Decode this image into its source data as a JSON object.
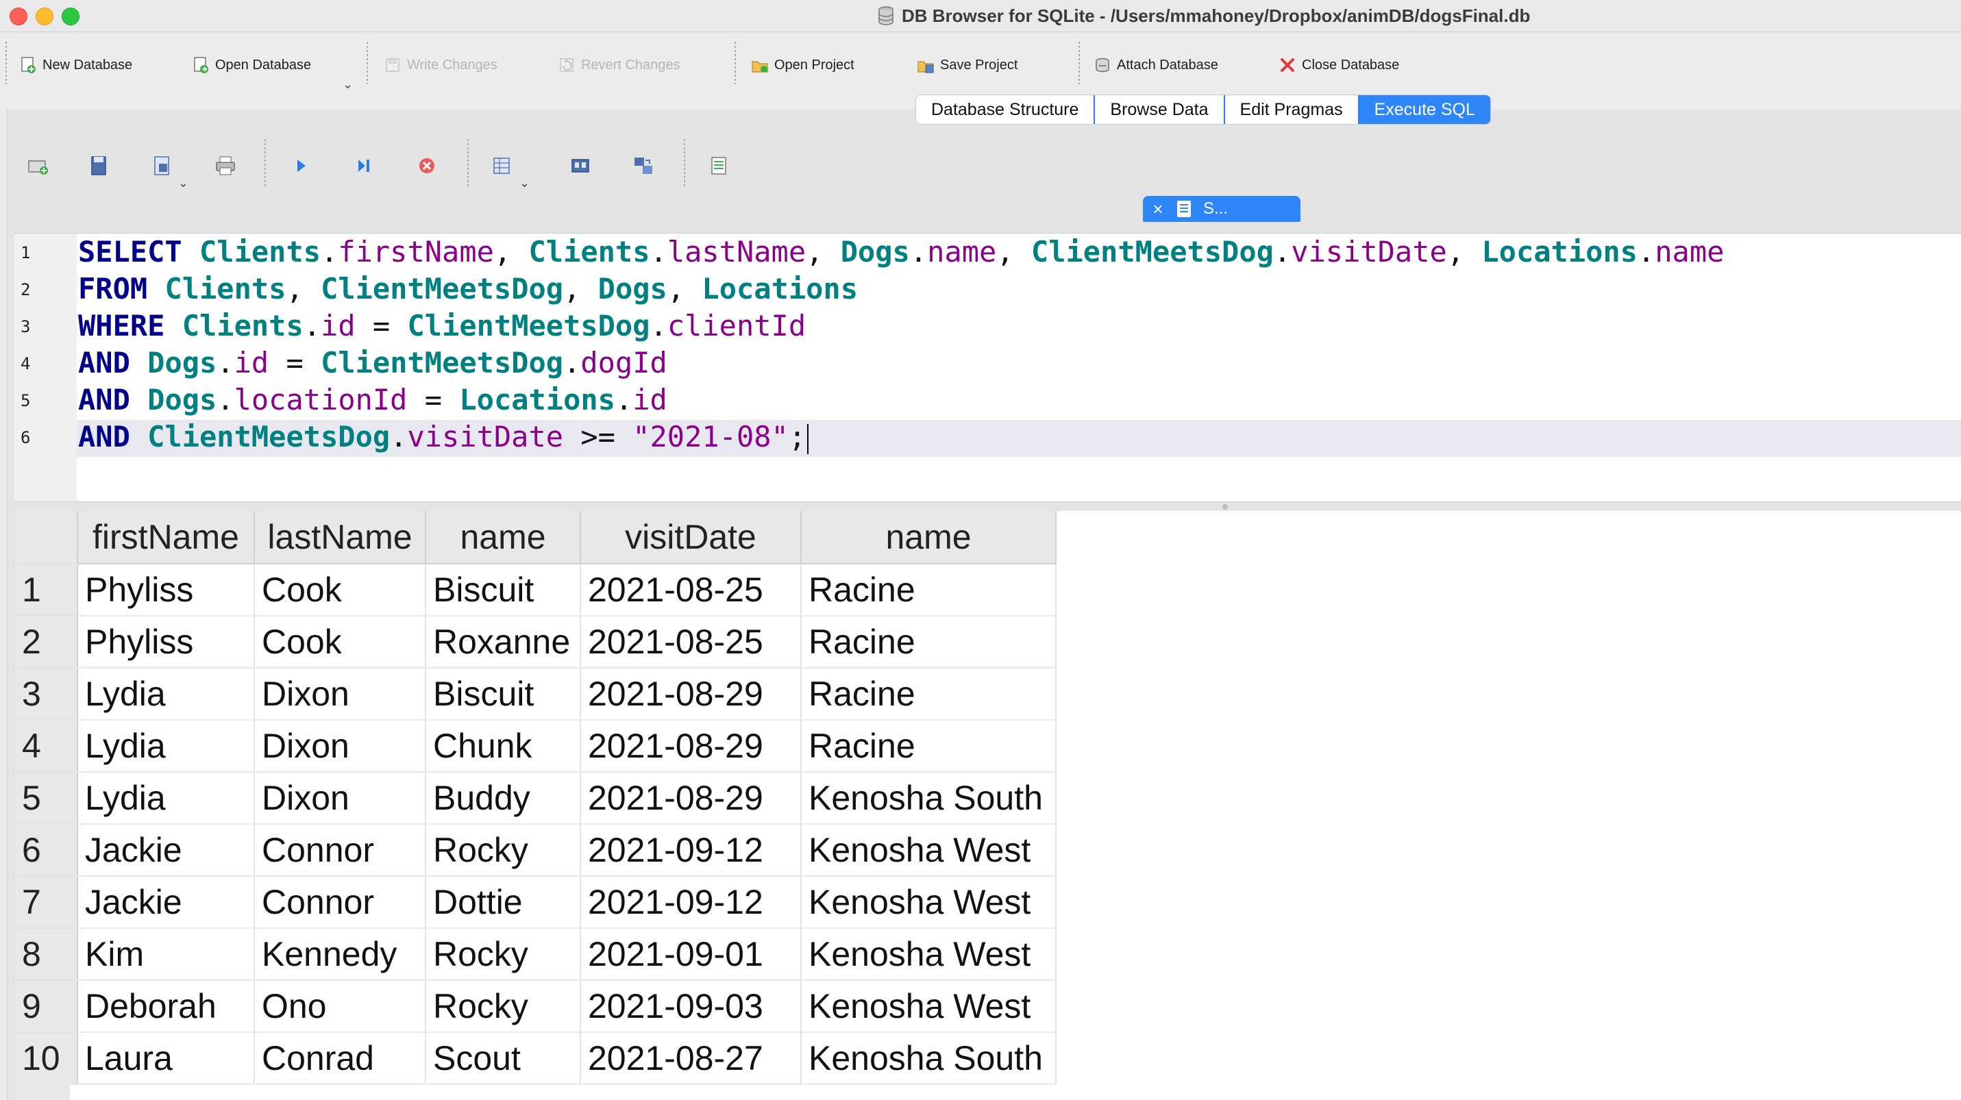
{
  "window": {
    "title": "DB Browser for SQLite - /Users/mmahoney/Dropbox/animDB/dogsFinal.db"
  },
  "toolbar": {
    "new_database": "New Database",
    "open_database": "Open Database",
    "write_changes": "Write Changes",
    "revert_changes": "Revert Changes",
    "open_project": "Open Project",
    "save_project": "Save Project",
    "attach_database": "Attach Database",
    "close_database": "Close Database"
  },
  "tabs": [
    "Database Structure",
    "Browse Data",
    "Edit Pragmas",
    "Execute SQL"
  ],
  "active_tab": "Execute SQL",
  "sql_editor": {
    "tab_label": "S...",
    "line_numbers": [
      "1",
      "2",
      "3",
      "4",
      "5",
      "6"
    ],
    "lines": [
      "SELECT Clients.firstName, Clients.lastName, Dogs.name, ClientMeetsDog.visitDate, Locations.name",
      "FROM Clients, ClientMeetsDog, Dogs, Locations",
      "WHERE Clients.id = ClientMeetsDog.clientId",
      "AND Dogs.id = ClientMeetsDog.dogId",
      "AND Dogs.locationId = Locations.id",
      "AND ClientMeetsDog.visitDate >= \"2021-08\";"
    ],
    "colors": {
      "keyword": "#00008b",
      "table": "#008080",
      "field": "#8b008b"
    }
  },
  "results": {
    "columns": [
      "firstName",
      "lastName",
      "name",
      "visitDate",
      "name"
    ],
    "rows": [
      {
        "num": "1",
        "cells": [
          "Phyliss",
          "Cook",
          "Biscuit",
          "2021-08-25",
          "Racine"
        ]
      },
      {
        "num": "2",
        "cells": [
          "Phyliss",
          "Cook",
          "Roxanne",
          "2021-08-25",
          "Racine"
        ]
      },
      {
        "num": "3",
        "cells": [
          "Lydia",
          "Dixon",
          "Biscuit",
          "2021-08-29",
          "Racine"
        ]
      },
      {
        "num": "4",
        "cells": [
          "Lydia",
          "Dixon",
          "Chunk",
          "2021-08-29",
          "Racine"
        ]
      },
      {
        "num": "5",
        "cells": [
          "Lydia",
          "Dixon",
          "Buddy",
          "2021-08-29",
          "Kenosha South"
        ]
      },
      {
        "num": "6",
        "cells": [
          "Jackie",
          "Connor",
          "Rocky",
          "2021-09-12",
          "Kenosha West"
        ]
      },
      {
        "num": "7",
        "cells": [
          "Jackie",
          "Connor",
          "Dottie",
          "2021-09-12",
          "Kenosha West"
        ]
      },
      {
        "num": "8",
        "cells": [
          "Kim",
          "Kennedy",
          "Rocky",
          "2021-09-01",
          "Kenosha West"
        ]
      },
      {
        "num": "9",
        "cells": [
          "Deborah",
          "Ono",
          "Rocky",
          "2021-09-03",
          "Kenosha West"
        ]
      },
      {
        "num": "10",
        "cells": [
          "Laura",
          "Conrad",
          "Scout",
          "2021-08-27",
          "Kenosha South"
        ]
      }
    ]
  },
  "accent_color": "#2f86f8"
}
